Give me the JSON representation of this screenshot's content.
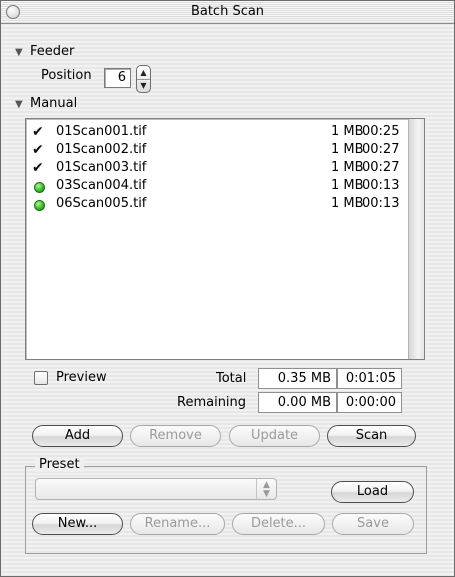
{
  "window": {
    "title": "Batch Scan"
  },
  "feeder": {
    "label": "Feeder",
    "position_label": "Position",
    "position_value": "6"
  },
  "manual": {
    "label": "Manual"
  },
  "files": [
    {
      "status": "done",
      "name": "01Scan001.tif",
      "size": "1 MB",
      "time": "00:25"
    },
    {
      "status": "done",
      "name": "01Scan002.tif",
      "size": "1 MB",
      "time": "00:27"
    },
    {
      "status": "done",
      "name": "01Scan003.tif",
      "size": "1 MB",
      "time": "00:27"
    },
    {
      "status": "pending",
      "name": "03Scan004.tif",
      "size": "1 MB",
      "time": "00:13"
    },
    {
      "status": "pending",
      "name": "06Scan005.tif",
      "size": "1 MB",
      "time": "00:13"
    }
  ],
  "preview": {
    "label": "Preview",
    "checked": false
  },
  "totals": {
    "total_label": "Total",
    "total_size": "0.35 MB",
    "total_time": "0:01:05",
    "remaining_label": "Remaining",
    "remaining_size": "0.00 MB",
    "remaining_time": "0:00:00"
  },
  "actions": {
    "add": "Add",
    "remove": "Remove",
    "update": "Update",
    "scan": "Scan"
  },
  "preset": {
    "label": "Preset",
    "selected": "",
    "load": "Load",
    "new": "New...",
    "rename": "Rename...",
    "delete": "Delete...",
    "save": "Save"
  },
  "icons": {
    "done": "checkmark-icon",
    "pending": "green-dot-icon"
  },
  "colors": {
    "status_green": "#3bbf2a"
  }
}
